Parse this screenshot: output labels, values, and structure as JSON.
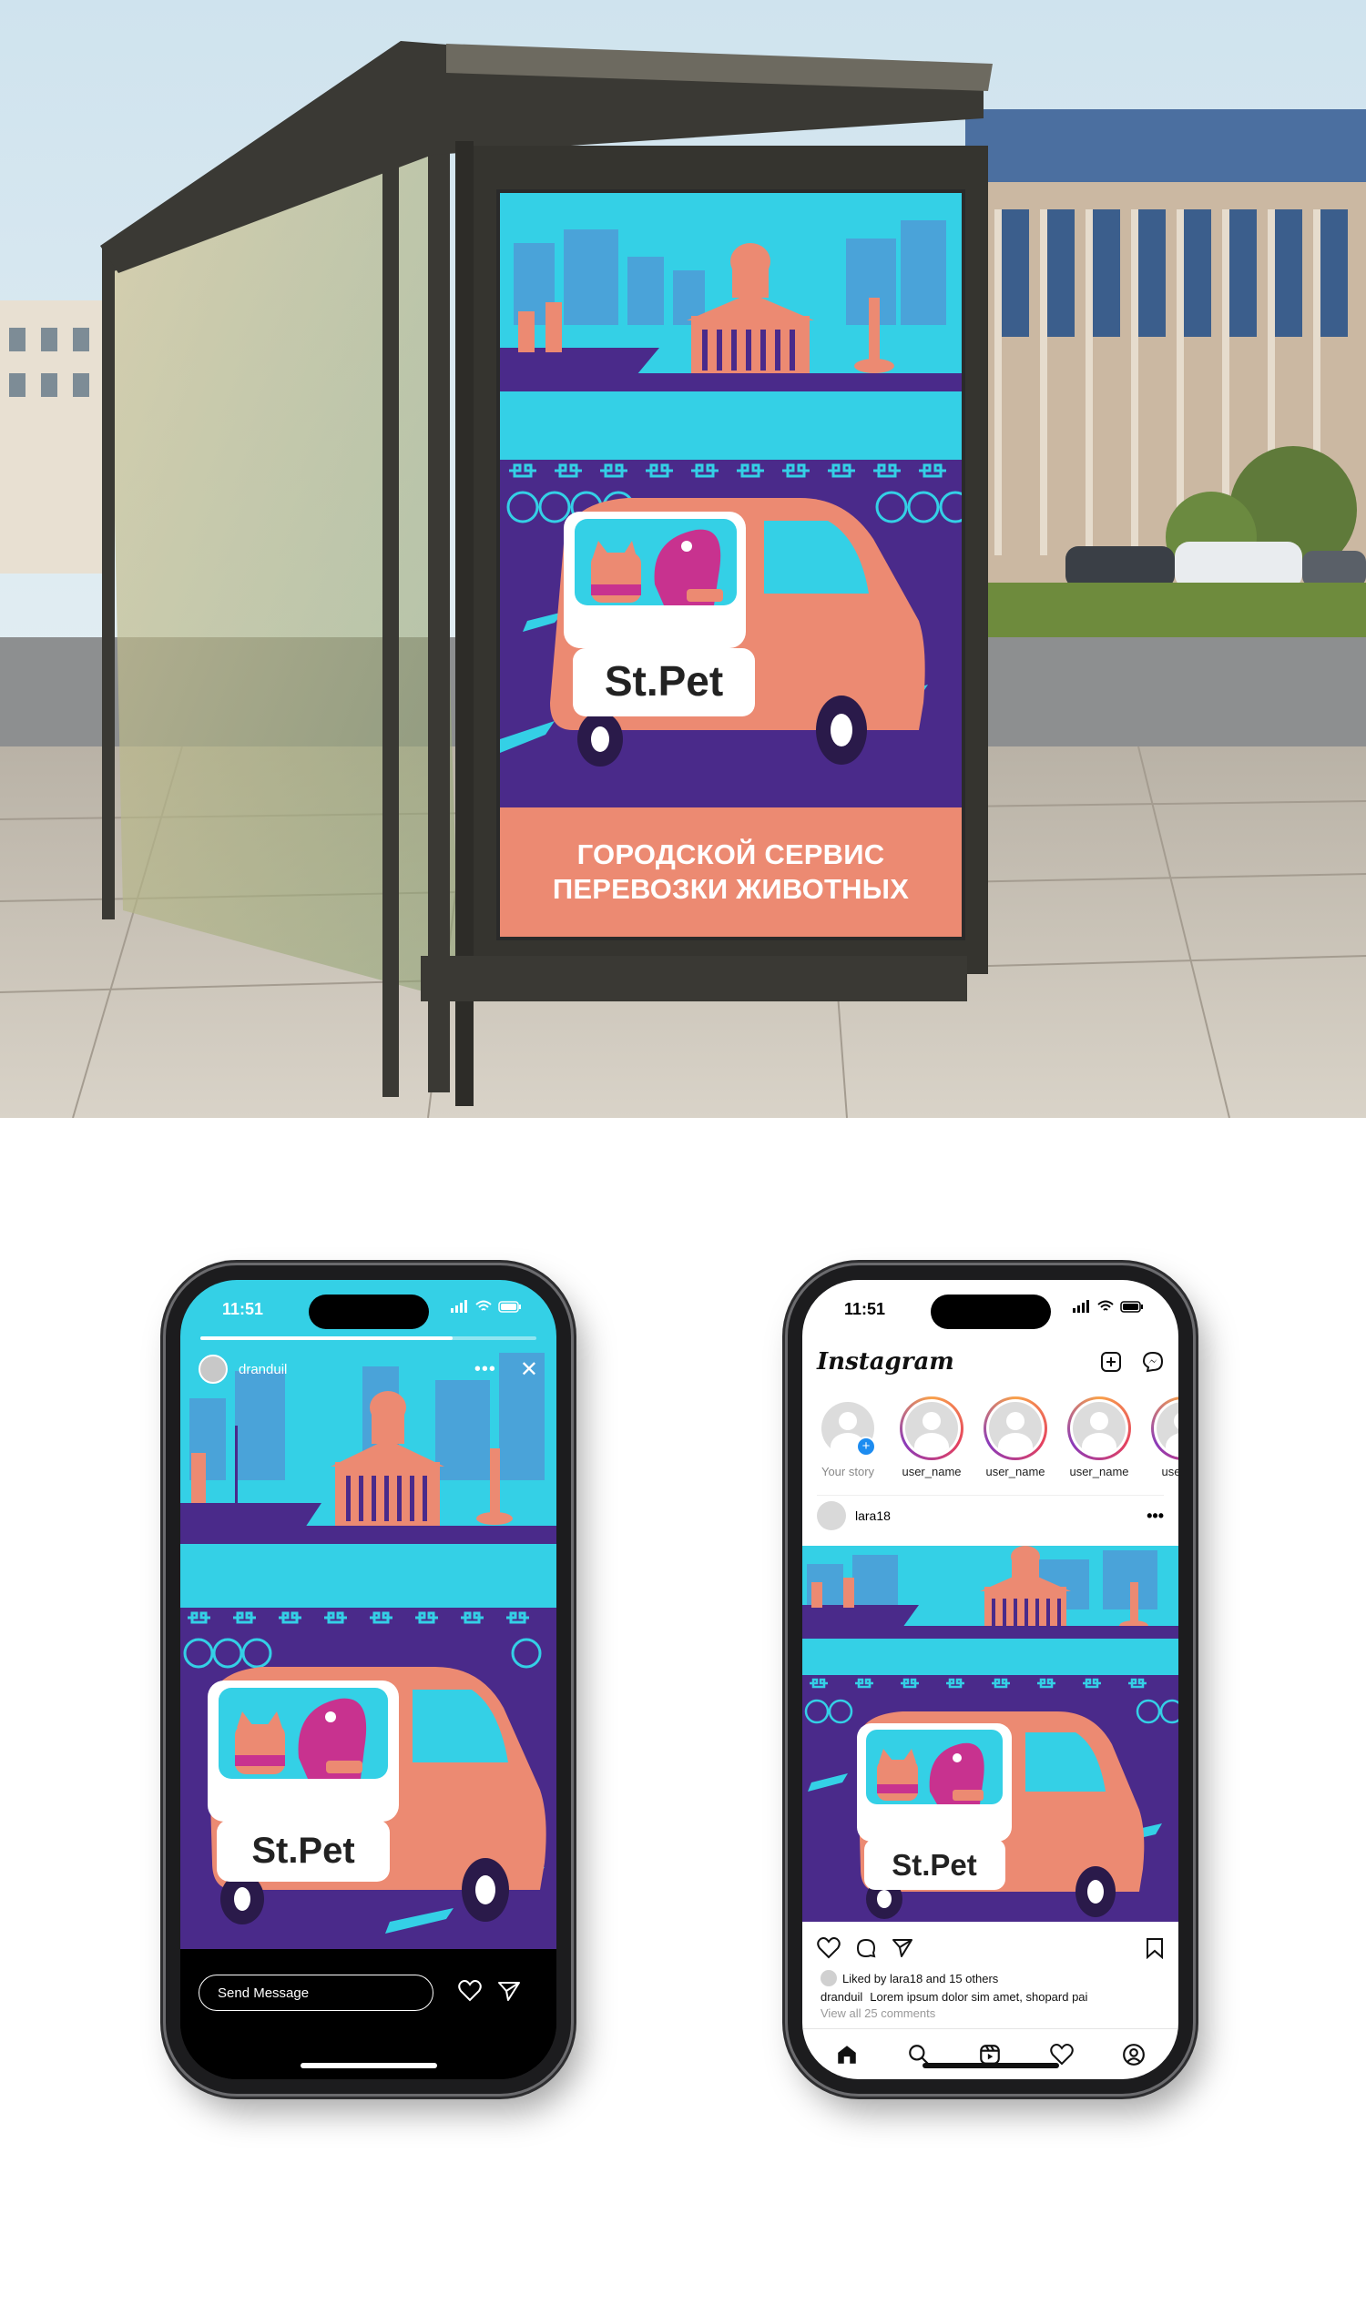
{
  "poster": {
    "brand": "St.Pet",
    "headline_line1": "ГОРОДСКОЙ СЕРВИС",
    "headline_line2": "ПЕРЕВОЗКИ ЖИВОТНЫХ"
  },
  "story_phone": {
    "time": "11:51",
    "username": "dranduil",
    "more_label": "•••",
    "close_label": "✕",
    "progress": 0.75,
    "brand": "St.Pet",
    "send_message_placeholder": "Send Message"
  },
  "feed_phone": {
    "time": "11:51",
    "app_logo": "Instagram",
    "stories": [
      {
        "label": "Your story",
        "own": true
      },
      {
        "label": "user_name"
      },
      {
        "label": "user_name"
      },
      {
        "label": "user_name"
      },
      {
        "label": "user_na"
      }
    ],
    "post": {
      "author": "lara18",
      "more_label": "•••",
      "brand": "St.Pet",
      "likes_text": "Liked by lara18 and 15 others",
      "caption_user": "dranduil",
      "caption_text": "Lorem ipsum dolor sim amet, shopard pai",
      "view_comments": "View all 25 comments"
    },
    "tabs": [
      "home-icon",
      "search-icon",
      "reels-icon",
      "heart-icon",
      "profile-icon"
    ]
  },
  "colors": {
    "sky": "#34d0e6",
    "skyline": "#4aa3d9",
    "purple": "#4a2a8a",
    "salmon": "#ec8a72",
    "magenta": "#c8328f",
    "teal": "#3fd3e6"
  }
}
